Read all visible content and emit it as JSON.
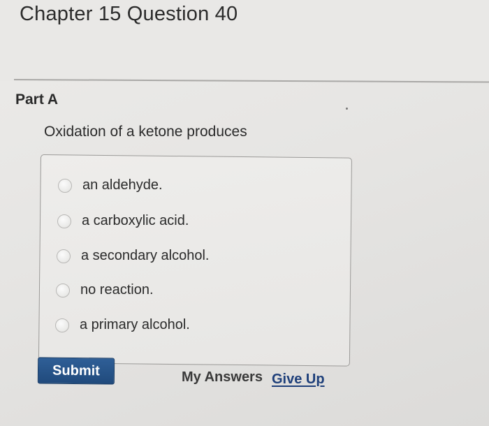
{
  "page": {
    "title": "Chapter 15 Question 40"
  },
  "part": {
    "label": "Part A"
  },
  "question": {
    "text": "Oxidation of a ketone produces",
    "choices": [
      {
        "label": "an aldehyde.",
        "selected": false
      },
      {
        "label": "a carboxylic acid.",
        "selected": false
      },
      {
        "label": "a secondary alcohol.",
        "selected": false
      },
      {
        "label": "no reaction.",
        "selected": false
      },
      {
        "label": "a primary alcohol.",
        "selected": false
      }
    ]
  },
  "actions": {
    "submit_label": "Submit",
    "my_answers_label": "My Answers",
    "give_up_label": "Give Up"
  },
  "colors": {
    "submit_button": "#2a5689",
    "give_up_link": "#1e3f7a",
    "background": "#e8e7e5"
  }
}
